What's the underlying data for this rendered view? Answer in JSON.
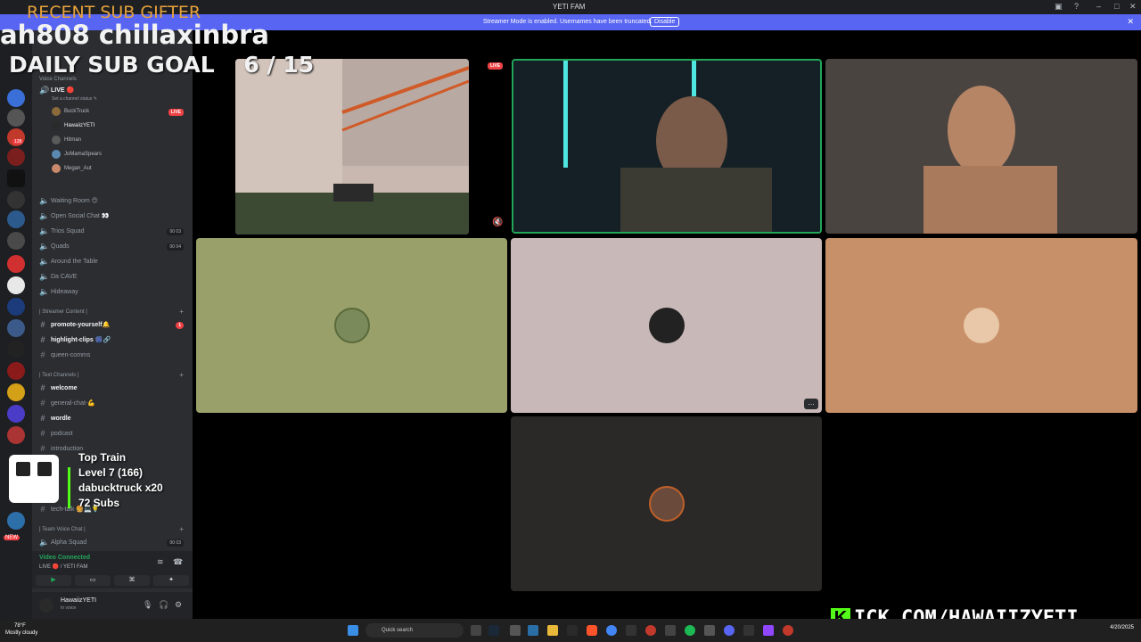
{
  "window": {
    "title": "YETI FAM",
    "min": "–",
    "max": "□",
    "close": "✕"
  },
  "streamer_bar": {
    "message": "Streamer Mode is enabled. Usernames have been truncated.",
    "disable_label": "Disable",
    "dismiss": "✕"
  },
  "overlay": {
    "gifter_label": "RECENT SUB GIFTER",
    "gifter_names": "ah808     chillaxinbra",
    "goal_label": "DAILY SUB GOAL",
    "goal_value": "6 / 15",
    "train_title": "Top Train",
    "train_level": "Level 7  (166)",
    "train_user": "dabucktruck x20",
    "train_subs": "72 Subs",
    "kick_url": "ICK.COM/HAWAIIZYETI"
  },
  "sidebar": {
    "voice_category": "Voice Channels",
    "live_channel": "LIVE 🔴",
    "channel_status": "Set a channel status ✎",
    "members": [
      "BuckTruck",
      "HawaiizYETI",
      "Hitman",
      "JoMamaSpears",
      "Megan_Aut"
    ],
    "live_badge": "LIVE",
    "voice_channels": [
      "Waiting Room 😊",
      "Open Social Chat 👀",
      "Trios Squad",
      "Quads",
      "Around the Table",
      "Da CAVE",
      "Hideaway"
    ],
    "trios_count": "00 03",
    "quads_count": "00 04",
    "streamer_category": "| Streamer Content |",
    "streamer_channels": [
      "promote-yourself🔔",
      "highlight-clips 🎆🔗",
      "queen-comms"
    ],
    "text_category": "| Text Channels |",
    "text_channels": [
      "welcome",
      "general-chat-💪",
      "wordle",
      "podcast",
      "introduction",
      "tech-talk 🍔💻💡"
    ],
    "team_category": "| Team Voice Chat |",
    "team_channels": [
      "Alpha Squad"
    ],
    "alpha_count": "00 03",
    "voice_connected": "Video Connected",
    "voice_location": "LIVE 🔴 / YETI FAM",
    "user_name": "HawaiizYETI",
    "user_status": "In voice"
  },
  "stage": {
    "live_badge": "LIVE"
  },
  "taskbar": {
    "temp": "78°F",
    "weather": "Mostly cloudy",
    "search_placeholder": "Quick search",
    "date": "4/20/2025"
  },
  "colors": {
    "accent": "#5865f2",
    "live": "#ed4245",
    "kick": "#53fc18",
    "tile_green": "#9aa06a",
    "tile_pink": "#c9b8b8",
    "tile_orange": "#c89068",
    "tile_dark": "#2a2927"
  }
}
